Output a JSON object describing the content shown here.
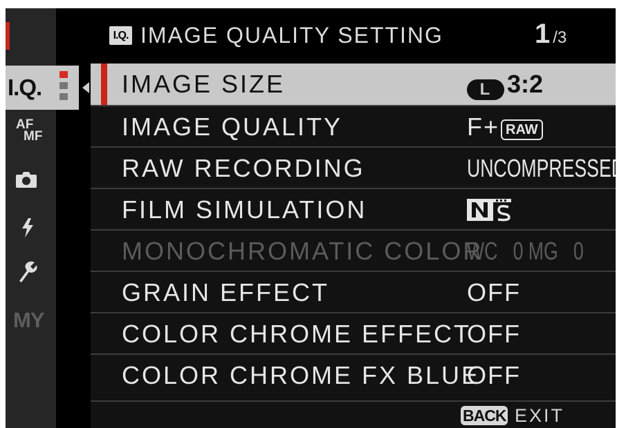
{
  "header": {
    "badge": "I.Q.",
    "title": "IMAGE QUALITY SETTING",
    "page_current": "1",
    "page_total": "/3"
  },
  "sidebar": {
    "iq_label": "I.Q.",
    "af_top": "AF",
    "af_bottom": "MF",
    "my_label": "MY",
    "icons": [
      "camera-icon",
      "flash-icon",
      "wrench-icon"
    ],
    "active_tab": "I.Q.",
    "accent": "#c8261e"
  },
  "menu": {
    "rows": [
      {
        "label": "IMAGE SIZE",
        "value_badge": "L",
        "value": "3:2",
        "selected": true
      },
      {
        "label": "IMAGE QUALITY",
        "value": "F+",
        "value_badge": "RAW"
      },
      {
        "label": "RAW RECORDING",
        "value": "UNCOMPRESSED"
      },
      {
        "label": "FILM SIMULATION",
        "value_icon": "film-simulation-icon"
      },
      {
        "label": "MONOCHROMATIC COLOR",
        "value": "WC   0 MG   0",
        "disabled": true
      },
      {
        "label": "GRAIN EFFECT",
        "value": "OFF"
      },
      {
        "label": "COLOR CHROME EFFECT",
        "value": "OFF"
      },
      {
        "label": "COLOR CHROME FX BLUE",
        "value": "OFF"
      }
    ]
  },
  "footer": {
    "back_label": "BACK",
    "exit_label": "EXIT"
  }
}
